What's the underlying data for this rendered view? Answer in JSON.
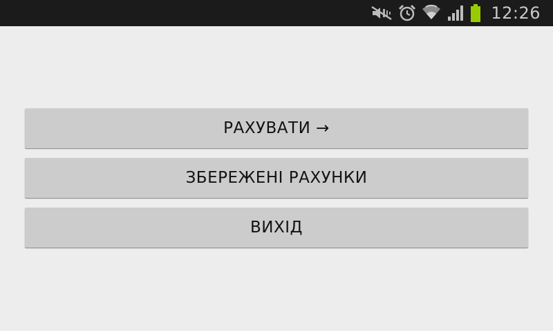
{
  "status_bar": {
    "time": "12:26",
    "icons": [
      "mute-icon",
      "alarm-icon",
      "wifi-icon",
      "signal-icon",
      "battery-icon"
    ],
    "battery_color": "#99cc00"
  },
  "menu": {
    "calculate_label": "РАХУВАТИ →",
    "saved_label": "ЗБЕРЕЖЕНІ РАХУНКИ",
    "exit_label": "ВИХІД"
  },
  "colors": {
    "background": "#ededed",
    "button": "#cccccc",
    "status_bar": "#1b1b1b"
  }
}
